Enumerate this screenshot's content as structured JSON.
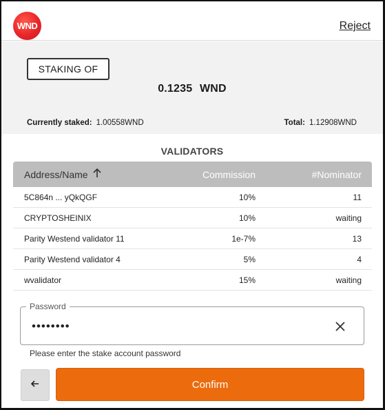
{
  "header": {
    "logo_text": "WND",
    "reject_label": "Reject"
  },
  "summary": {
    "staking_label": "STAKING OF",
    "amount_value": "0.1235",
    "amount_unit": "WND",
    "currently_staked_label": "Currently staked:",
    "currently_staked_value": "1.00558WND",
    "total_label": "Total:",
    "total_value": "1.12908WND"
  },
  "validators": {
    "title": "VALIDATORS",
    "columns": {
      "name": "Address/Name",
      "commission": "Commission",
      "nominator": "#Nominator"
    },
    "sort_icon": "arrow-up-icon",
    "rows": [
      {
        "name": "5C864n ... yQkQGF",
        "commission": "10%",
        "nominator": "11"
      },
      {
        "name": "CRYPTOSHEINIX",
        "commission": "10%",
        "nominator": "waiting"
      },
      {
        "name": "Parity Westend validator 11",
        "commission": "1e-7%",
        "nominator": "13"
      },
      {
        "name": "Parity Westend validator 4",
        "commission": "5%",
        "nominator": "4"
      },
      {
        "name": "wvalidator",
        "commission": "15%",
        "nominator": "waiting"
      }
    ]
  },
  "password": {
    "label": "Password",
    "value": "••••••••",
    "clear_icon": "close-icon",
    "helper_text": "Please enter the stake account password"
  },
  "actions": {
    "back_icon": "arrow-left-icon",
    "confirm_label": "Confirm"
  },
  "colors": {
    "brand": "#e8262a",
    "accent": "#ec6b0d",
    "table_header": "#bdbdbd",
    "summary_bg": "#f2f2f2"
  }
}
